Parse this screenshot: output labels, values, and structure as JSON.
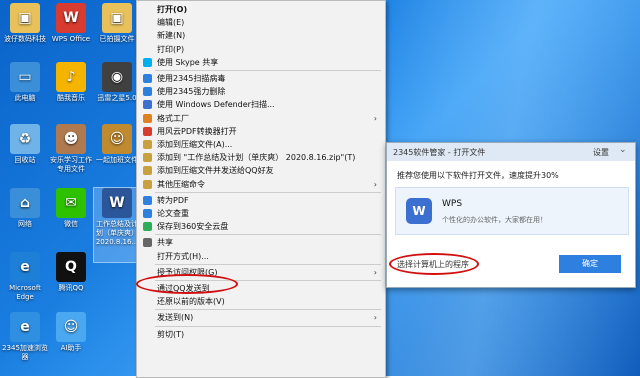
{
  "desktop_icons": [
    {
      "label": "波仔数码科技",
      "icon": "user-folder-icon",
      "color": "#e8c15a",
      "selected": false
    },
    {
      "label": "WPS Office",
      "icon": "wps-icon",
      "color": "#d83b2f",
      "selected": false
    },
    {
      "label": "已拍摄文件",
      "icon": "folder-icon",
      "color": "#e8c15a",
      "selected": false
    },
    {
      "label": "此电脑",
      "icon": "computer-icon",
      "color": "#3b8fd8",
      "selected": false
    },
    {
      "label": "酷我音乐",
      "icon": "kuwo-music-icon",
      "color": "#f4b400",
      "selected": false
    },
    {
      "label": "迅雷之星5.0",
      "icon": "camera-icon",
      "color": "#404040",
      "selected": false
    },
    {
      "label": "回收站",
      "icon": "recycle-bin-icon",
      "color": "#6fb3e8",
      "selected": false
    },
    {
      "label": "安乐学习工作专用文件",
      "icon": "photo-icon",
      "color": "#b07a50",
      "selected": false
    },
    {
      "label": "一起加班文件",
      "icon": "character-icon",
      "color": "#c08a30",
      "selected": false
    },
    {
      "label": "网络",
      "icon": "network-icon",
      "color": "#3b8fd8",
      "selected": false
    },
    {
      "label": "微信",
      "icon": "wechat-icon",
      "color": "#2dc100",
      "selected": false
    },
    {
      "label": "工作总结及计划（单庆爽）2020.8.16...",
      "icon": "word-document-icon",
      "color": "#2b579a",
      "selected": true
    },
    {
      "label": "Microsoft Edge",
      "icon": "edge-icon",
      "color": "#1e7fd6",
      "selected": false
    },
    {
      "label": "腾讯QQ",
      "icon": "qq-icon",
      "color": "#111111",
      "selected": false
    },
    {
      "label": "2345加速浏览器",
      "icon": "browser-icon",
      "color": "#2f8fe0",
      "selected": false
    },
    {
      "label": "AI助手",
      "icon": "ai-robot-icon",
      "color": "#4aa8f0",
      "selected": false
    }
  ],
  "context_menu": {
    "items": [
      {
        "label": "打开(O)",
        "bold": true,
        "icon": "",
        "arrow": false
      },
      {
        "label": "编辑(E)",
        "icon": "",
        "arrow": false
      },
      {
        "label": "新建(N)",
        "icon": "",
        "arrow": false
      },
      {
        "label": "打印(P)",
        "icon": "",
        "arrow": false
      },
      {
        "label": "使用 Skype 共享",
        "icon": "skype-icon",
        "arrow": false
      },
      {
        "sep": true
      },
      {
        "label": "使用2345扫描病毒",
        "icon": "shield-icon",
        "arrow": false
      },
      {
        "label": "使用2345强力删除",
        "icon": "shield-icon",
        "arrow": false
      },
      {
        "label": "使用 Windows Defender扫描...",
        "icon": "defender-icon",
        "arrow": false
      },
      {
        "label": "格式工厂",
        "icon": "format-factory-icon",
        "arrow": true
      },
      {
        "label": "用风云PDF转换器打开",
        "icon": "pdf-icon",
        "arrow": false
      },
      {
        "label": "添加到压缩文件(A)...",
        "icon": "archive-icon",
        "arrow": false
      },
      {
        "label": "添加到 \"工作总结及计划（单庆爽） 2020.8.16.zip\"(T)",
        "icon": "archive-icon",
        "arrow": false
      },
      {
        "label": "添加到压缩文件并发送给QQ好友",
        "icon": "archive-icon",
        "arrow": false
      },
      {
        "label": "其他压缩命令",
        "icon": "archive-icon",
        "arrow": true
      },
      {
        "sep": true
      },
      {
        "label": "转为PDF",
        "icon": "pdf-convert-icon",
        "arrow": false
      },
      {
        "label": "论文查重",
        "icon": "paper-check-icon",
        "arrow": false
      },
      {
        "label": "保存到360安全云盘",
        "icon": "cloud-icon",
        "arrow": false
      },
      {
        "sep": true
      },
      {
        "label": "共享",
        "icon": "share-icon",
        "arrow": false
      },
      {
        "label": "打开方式(H)...",
        "icon": "",
        "arrow": false,
        "highlight": true
      },
      {
        "sep": true
      },
      {
        "label": "授予访问权限(G)",
        "icon": "",
        "arrow": true
      },
      {
        "sep": true
      },
      {
        "label": "通过QQ发送到",
        "icon": "",
        "arrow": false
      },
      {
        "label": "还原以前的版本(V)",
        "icon": "",
        "arrow": false
      },
      {
        "sep": true
      },
      {
        "label": "发送到(N)",
        "icon": "",
        "arrow": true
      },
      {
        "sep": true
      },
      {
        "label": "剪切(T)",
        "icon": "",
        "arrow": false
      }
    ]
  },
  "dialog": {
    "title": "2345软件管家 - 打开文件",
    "settings": "设置",
    "prompt": "推荐您使用以下软件打开文件，速度提升30%",
    "app_name": "WPS",
    "app_desc": "个性化的办公软件，大家都在用！",
    "link": "选择计算机上的程序",
    "ok": "确定"
  },
  "colors": {
    "accent": "#2d7fe0",
    "circle": "#d01010",
    "title_prefix": "#e23b2b"
  }
}
